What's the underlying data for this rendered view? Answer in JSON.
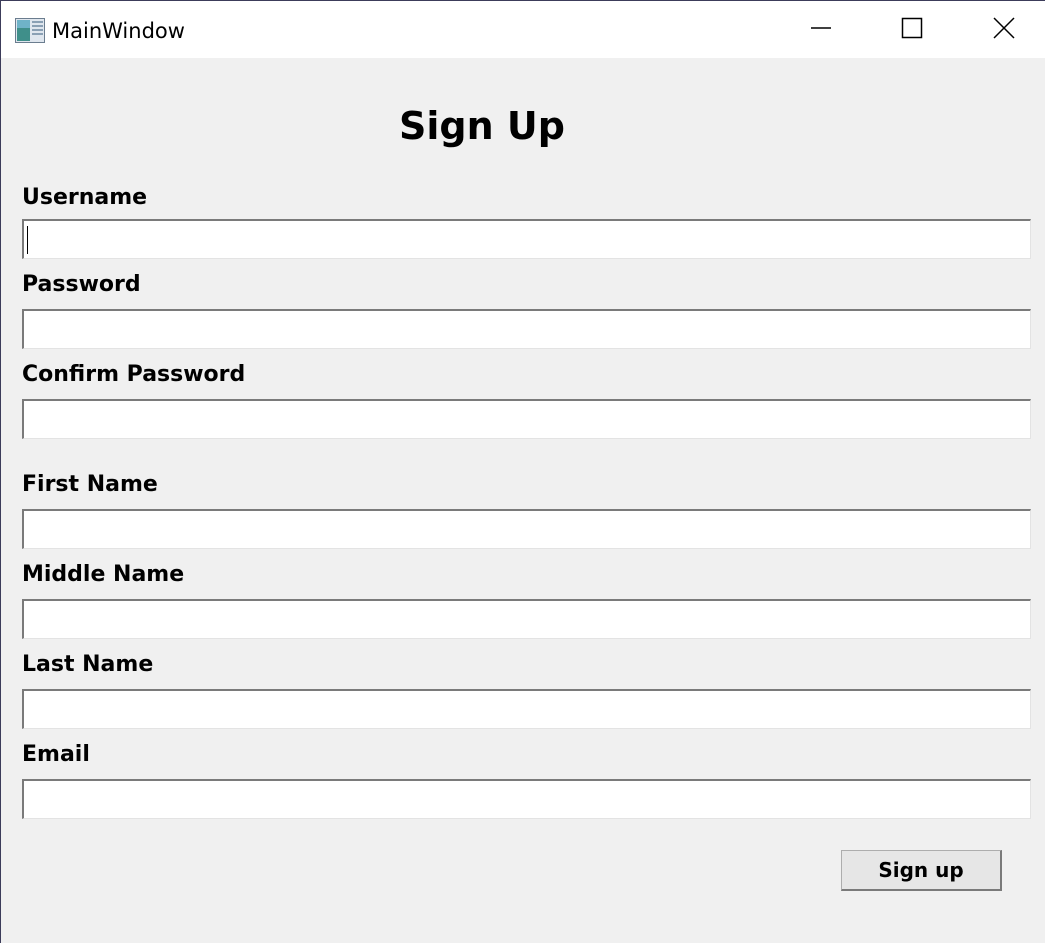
{
  "window": {
    "title": "MainWindow",
    "icons": {
      "app": "app-window-icon",
      "minimize": "minimize-icon",
      "maximize": "maximize-icon",
      "close": "close-icon"
    }
  },
  "form": {
    "heading": "Sign Up",
    "fields": [
      {
        "label": "Username",
        "value": ""
      },
      {
        "label": "Password",
        "value": ""
      },
      {
        "label": "Confirm Password",
        "value": ""
      },
      {
        "label": "First Name",
        "value": ""
      },
      {
        "label": "Middle Name",
        "value": ""
      },
      {
        "label": "Last Name",
        "value": ""
      },
      {
        "label": "Email",
        "value": ""
      }
    ],
    "submit_label": "Sign up"
  }
}
